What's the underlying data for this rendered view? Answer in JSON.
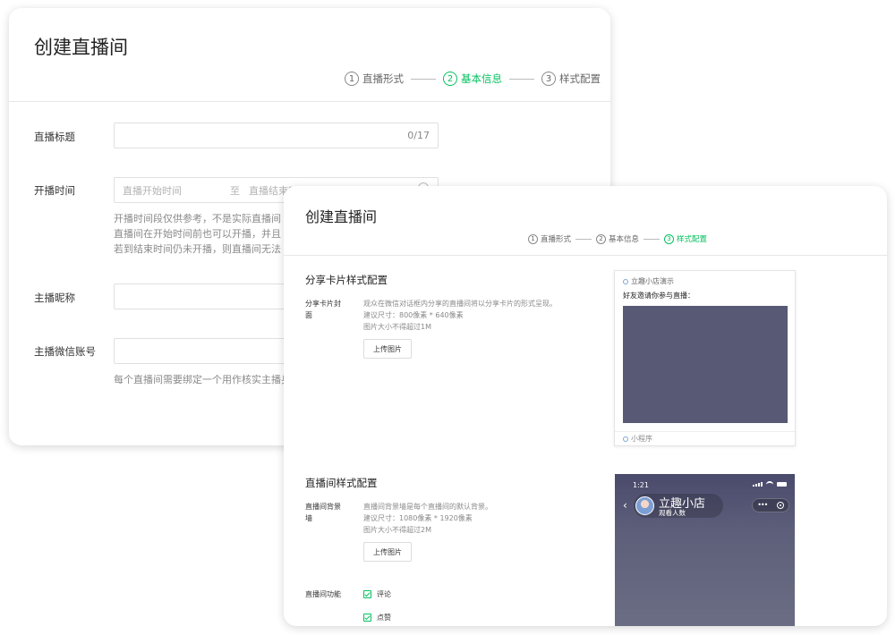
{
  "back_card": {
    "title": "创建直播间",
    "steps": [
      {
        "num": "1",
        "label": "直播形式"
      },
      {
        "num": "2",
        "label": "基本信息"
      },
      {
        "num": "3",
        "label": "样式配置"
      }
    ],
    "active_step": 2,
    "fields": {
      "title_label": "直播标题",
      "title_counter": "0/17",
      "time_label": "开播时间",
      "start_placeholder": "直播开始时间",
      "to_text": "至",
      "end_placeholder": "直播结束时间",
      "time_hint": [
        "开播时间段仅供参考，不是实际直播间",
        "直播间在开始时间前也可以开播，并且",
        "若到结束时间仍未开播，则直播间无法"
      ],
      "nickname_label": "主播昵称",
      "wechat_label": "主播微信账号",
      "wechat_hint": "每个直播间需要绑定一个用作核实主播身"
    }
  },
  "front_card": {
    "title": "创建直播间",
    "steps": [
      {
        "num": "1",
        "label": "直播形式"
      },
      {
        "num": "2",
        "label": "基本信息"
      },
      {
        "num": "3",
        "label": "样式配置"
      }
    ],
    "active_step": 3,
    "share_section": {
      "heading": "分享卡片样式配置",
      "label": "分享卡片封面",
      "desc": [
        "观众在微信对话框内分享的直播间将以分享卡片的形式呈现。",
        "建议尺寸：800像素 * 640像素",
        "图片大小不得超过1M"
      ],
      "upload_label": "上传图片",
      "preview": {
        "store_name": "立趣小店演示",
        "invite_text": "好友邀请你参与直播：",
        "footer": "小程序"
      }
    },
    "room_section": {
      "heading": "直播间样式配置",
      "label": "直播间背景墙",
      "desc": [
        "直播间背景墙是每个直播间的默认背景。",
        "建议尺寸：1080像素 * 1920像素",
        "图片大小不得超过2M"
      ],
      "upload_label": "上传图片",
      "features_label": "直播间功能",
      "features": [
        {
          "label": "评论",
          "checked": true
        },
        {
          "label": "点赞",
          "checked": true
        }
      ],
      "phone": {
        "time": "1:21",
        "store_name": "立趣小店",
        "viewers": "观看人数"
      }
    }
  },
  "colors": {
    "accent": "#07c160",
    "preview_image": "#585974",
    "phone_bg": "#5e607b"
  }
}
